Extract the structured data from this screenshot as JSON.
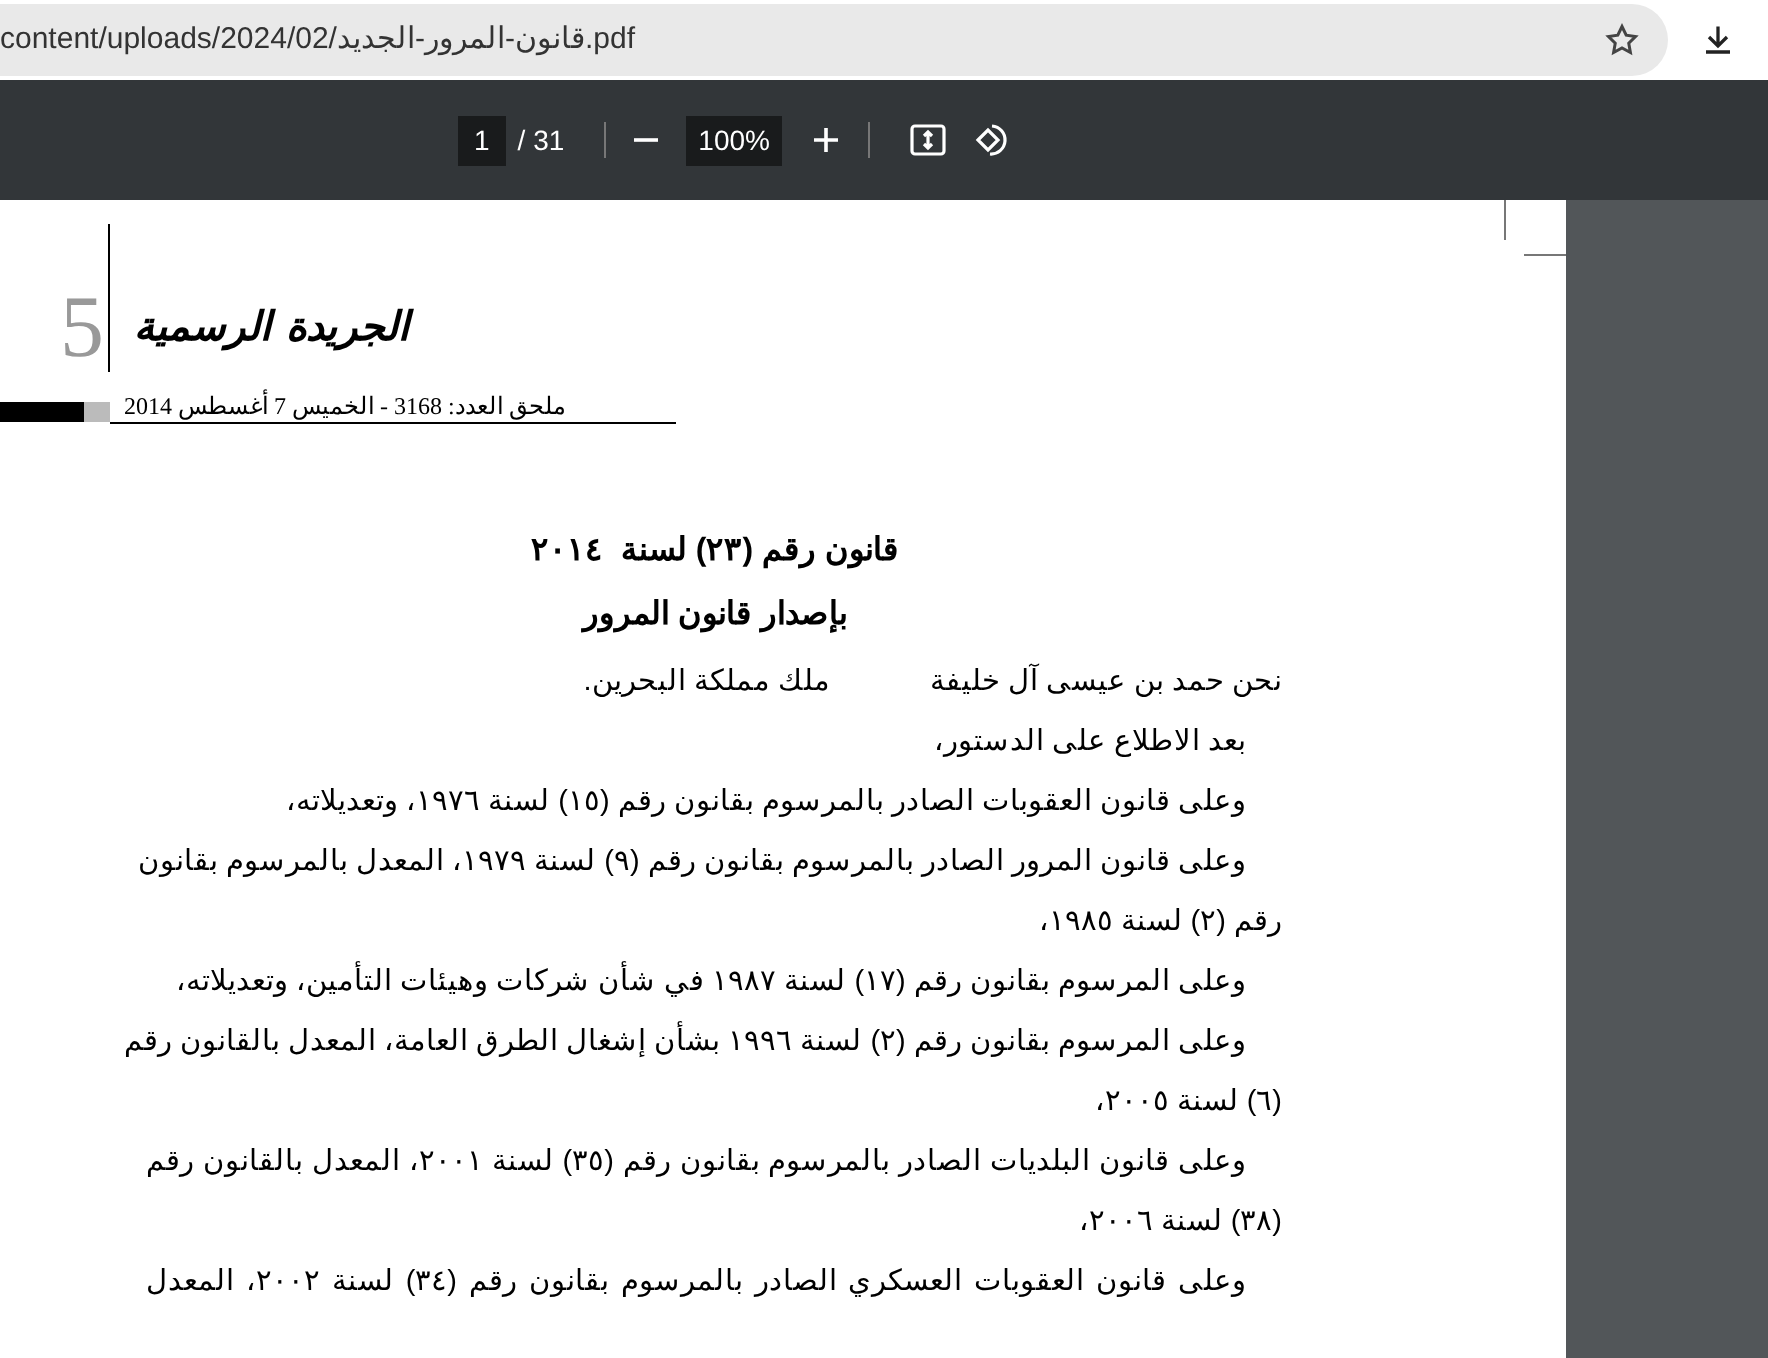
{
  "address_bar": {
    "url": "content/uploads/2024/02/قانون-المرور-الجديد.pdf"
  },
  "toolbar": {
    "page": "1",
    "page_count": "/ 31",
    "zoom": "100%"
  },
  "document": {
    "page_number": "5",
    "masthead": "الجريدة الرسمية",
    "issue_line": "ملحق العدد: 3168 - الخميس 7 أغسطس 2014",
    "title_lines": [
      "قانون رقم (٢٣) لسنة  ٢٠١٤",
      "بإصدار قانون المرور"
    ],
    "lines": [
      {
        "kind": "split",
        "parts": [
          "نحن حمد بن عيسى آل خليفة",
          "ملك مملكة البحرين."
        ]
      },
      {
        "kind": "first",
        "text": "بعد الاطلاع على الدستور،"
      },
      {
        "kind": "first",
        "text": "وعلى قانون العقوبات الصادر بالمرسوم بقانون رقم (١٥) لسنة ١٩٧٦، وتعديلاته،"
      },
      {
        "kind": "justified",
        "text": "وعلى قانون المرور الصادر بالمرسوم بقانون رقم (٩) لسنة ١٩٧٩، المعدل بالمرسوم بقانون"
      },
      {
        "kind": "last",
        "text": "رقم (٢) لسنة ١٩٨٥،"
      },
      {
        "kind": "first",
        "text": "وعلى المرسوم بقانون رقم (١٧) لسنة ١٩٨٧ في شأن شركات وهيئات التأمين، وتعديلاته،"
      },
      {
        "kind": "justified",
        "text": "وعلى المرسوم بقانون رقم (٢) لسنة ١٩٩٦ بشأن إشغال الطرق العامة، المعدل بالقانون رقم"
      },
      {
        "kind": "last",
        "text": "(٦) لسنة ٢٠٠٥،"
      },
      {
        "kind": "justified",
        "text": "وعلى قانون البلديات الصادر بالمرسوم بقانون رقم (٣٥) لسنة ٢٠٠١، المعدل بالقانون رقم"
      },
      {
        "kind": "last",
        "text": "(٣٨) لسنة ٢٠٠٦،"
      },
      {
        "kind": "justified",
        "text": "وعلى قانون العقوبات العسكري الصادر بالمرسوم بقانون رقم (٣٤) لسنة ٢٠٠٢، المعدل"
      }
    ]
  }
}
